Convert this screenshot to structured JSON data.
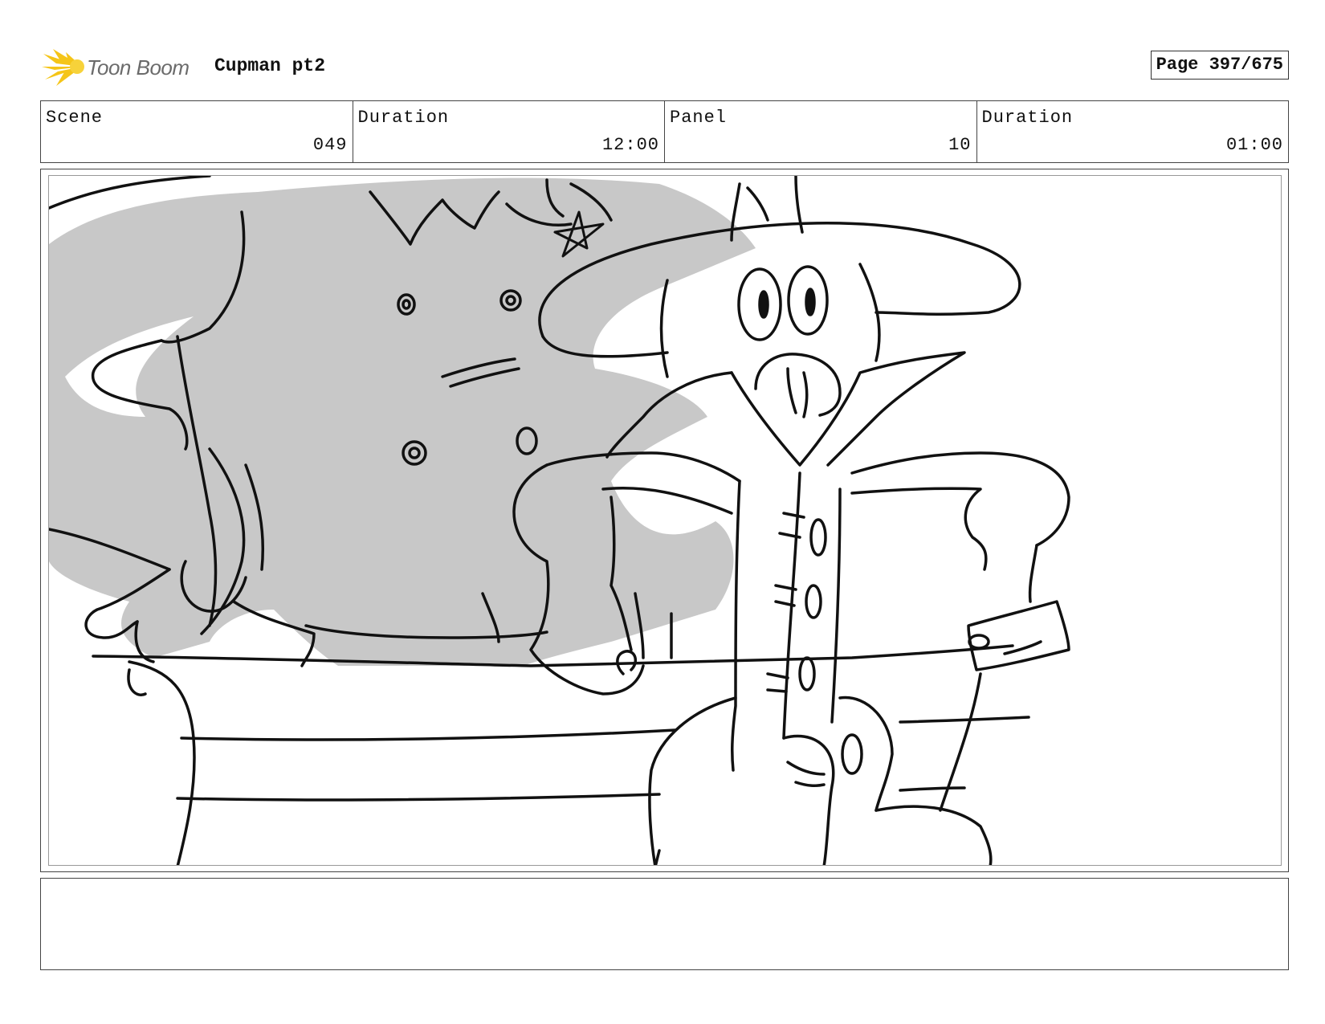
{
  "header": {
    "logo_text": "Toon Boom",
    "project_title": "Cupman pt2",
    "page_label": "Page 397/675"
  },
  "info": {
    "scene_label": "Scene",
    "scene_value": "049",
    "scene_duration_label": "Duration",
    "scene_duration_value": "12:00",
    "panel_label": "Panel",
    "panel_value": "10",
    "panel_duration_label": "Duration",
    "panel_duration_value": "01:00"
  },
  "notes": {
    "text": ""
  },
  "colors": {
    "logo_accent": "#f5c518",
    "fill_gray": "#c8c8c8"
  },
  "icons": {
    "logo": "sunburst-logo-icon"
  }
}
